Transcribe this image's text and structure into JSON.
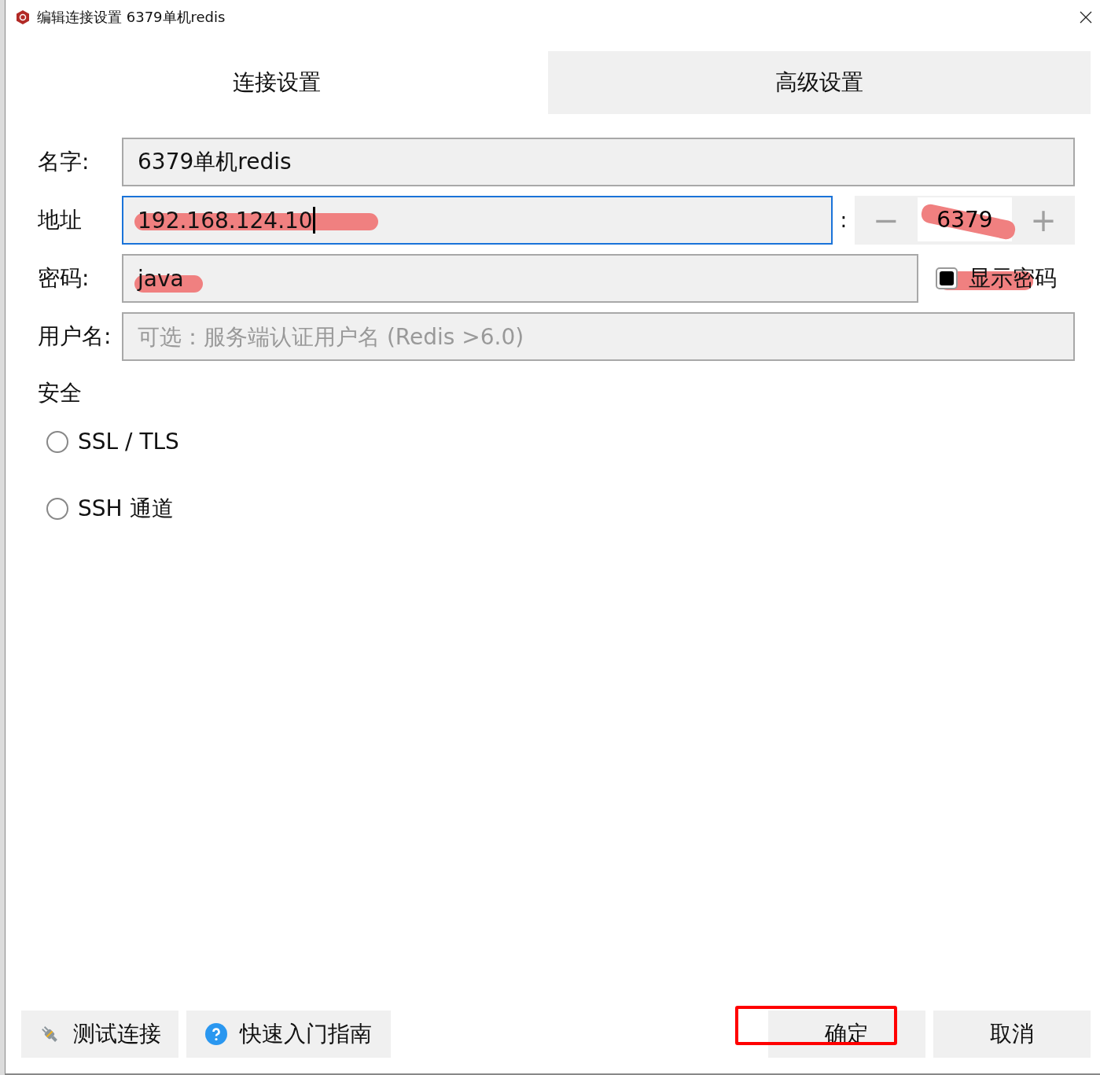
{
  "window": {
    "title": "编辑连接设置 6379单机redis"
  },
  "tabs": [
    {
      "label": "连接设置",
      "selected": true
    },
    {
      "label": "高级设置",
      "selected": false
    }
  ],
  "form": {
    "name": {
      "label": "名字:",
      "value": "6379单机redis"
    },
    "address": {
      "label": "地址",
      "value": "192.168.124.10",
      "focused": true,
      "redacted": true,
      "separator": ":",
      "port": {
        "minus": "−",
        "value": "6379",
        "plus": "+",
        "redacted": true
      }
    },
    "password": {
      "label": "密码:",
      "value": "java",
      "redacted": true,
      "show_password": {
        "label": "显示密码",
        "checked": true,
        "redacted": true
      }
    },
    "username": {
      "label": "用户名:",
      "placeholder": "可选：服务端认证用户名 (Redis >6.0)"
    }
  },
  "security": {
    "title": "安全",
    "options": [
      {
        "label": "SSL / TLS",
        "selected": false
      },
      {
        "label": "SSH 通道",
        "selected": false
      }
    ]
  },
  "buttons": [
    {
      "kind": "test",
      "label": "测试连接",
      "highlighted": false
    },
    {
      "kind": "help",
      "label": "快速入门指南",
      "highlighted": false
    },
    {
      "kind": "plain",
      "label": "确定",
      "highlighted": true
    },
    {
      "kind": "plain",
      "label": "取消",
      "highlighted": false
    }
  ]
}
